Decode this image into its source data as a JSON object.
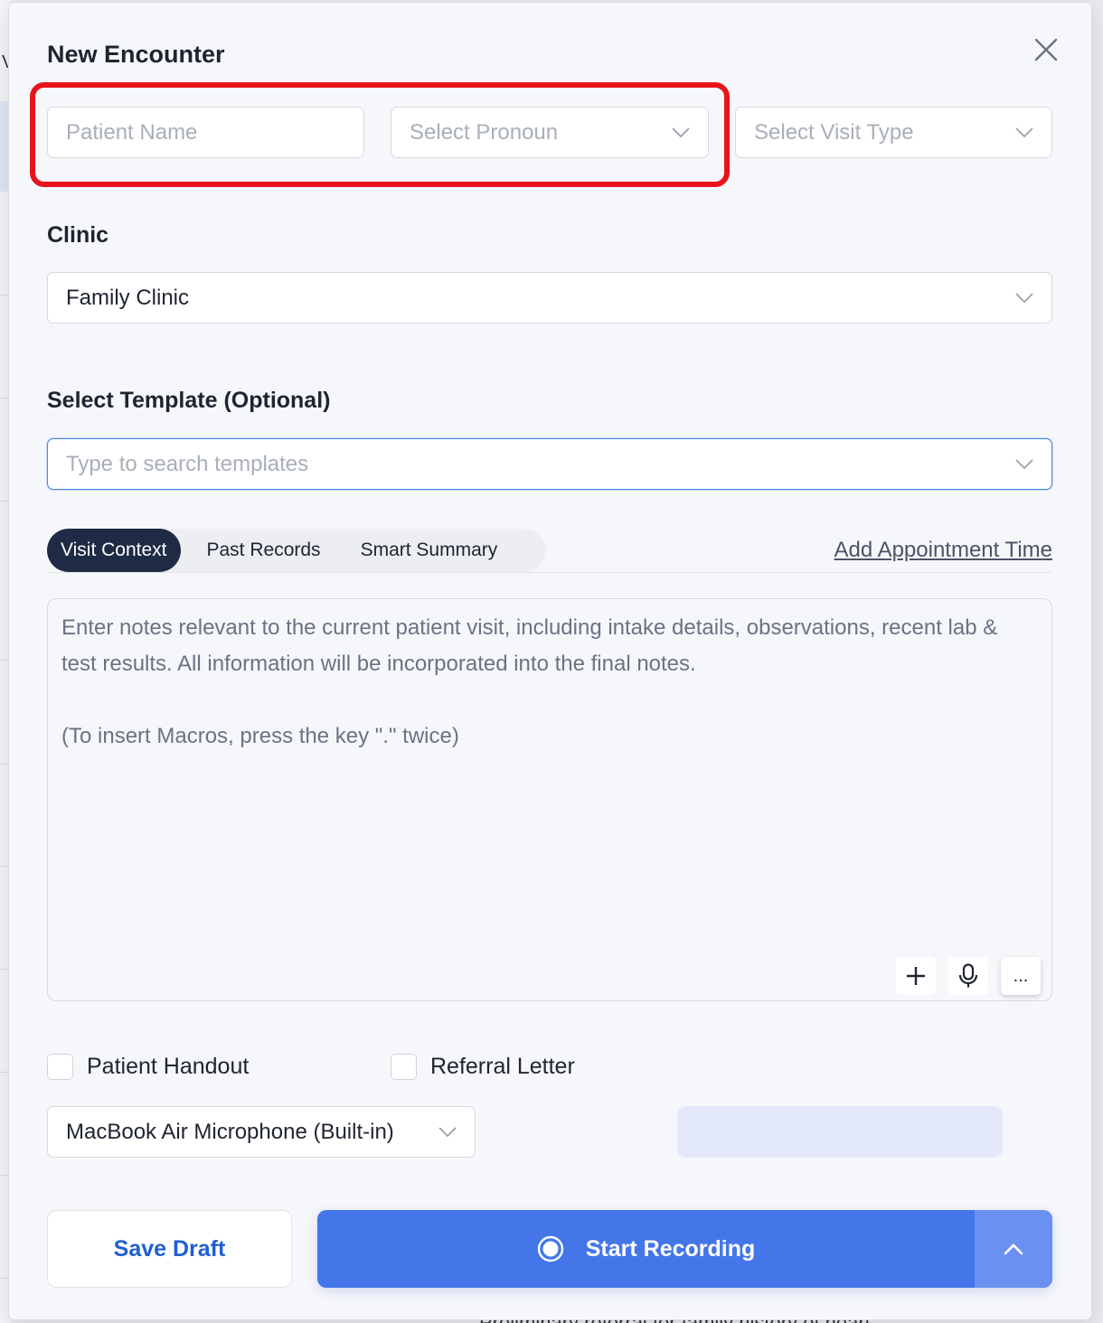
{
  "background": {
    "partial_letter": "V",
    "bottom_text": "Preliminary referral for family history of heart"
  },
  "modal": {
    "title": "New Encounter",
    "close_icon": "close-icon"
  },
  "patient": {
    "name_placeholder": "Patient Name",
    "pronoun_placeholder": "Select Pronoun",
    "visit_type_placeholder": "Select Visit Type"
  },
  "clinic": {
    "label": "Clinic",
    "value": "Family Clinic"
  },
  "template": {
    "label": "Select Template (Optional)",
    "placeholder": "Type to search templates"
  },
  "tabs": [
    {
      "label": "Visit Context",
      "active": true
    },
    {
      "label": "Past Records",
      "active": false
    },
    {
      "label": "Smart Summary",
      "active": false
    }
  ],
  "appointment_link": "Add Appointment Time",
  "notes": {
    "placeholder_line1": "Enter notes relevant to the current patient visit, including intake details, observations, recent lab & test results. All information will be incorporated into the final notes.",
    "placeholder_line2": "(To insert Macros, press the key \".\" twice)",
    "more_label": "..."
  },
  "options": {
    "patient_handout": "Patient Handout",
    "referral_letter": "Referral Letter"
  },
  "microphone": {
    "value": "MacBook Air Microphone (Built-in)"
  },
  "actions": {
    "save_draft": "Save Draft",
    "start_recording": "Start Recording"
  },
  "colors": {
    "accent": "#4476ea",
    "highlight": "#e8141c",
    "active_tab": "#1f2a44"
  }
}
